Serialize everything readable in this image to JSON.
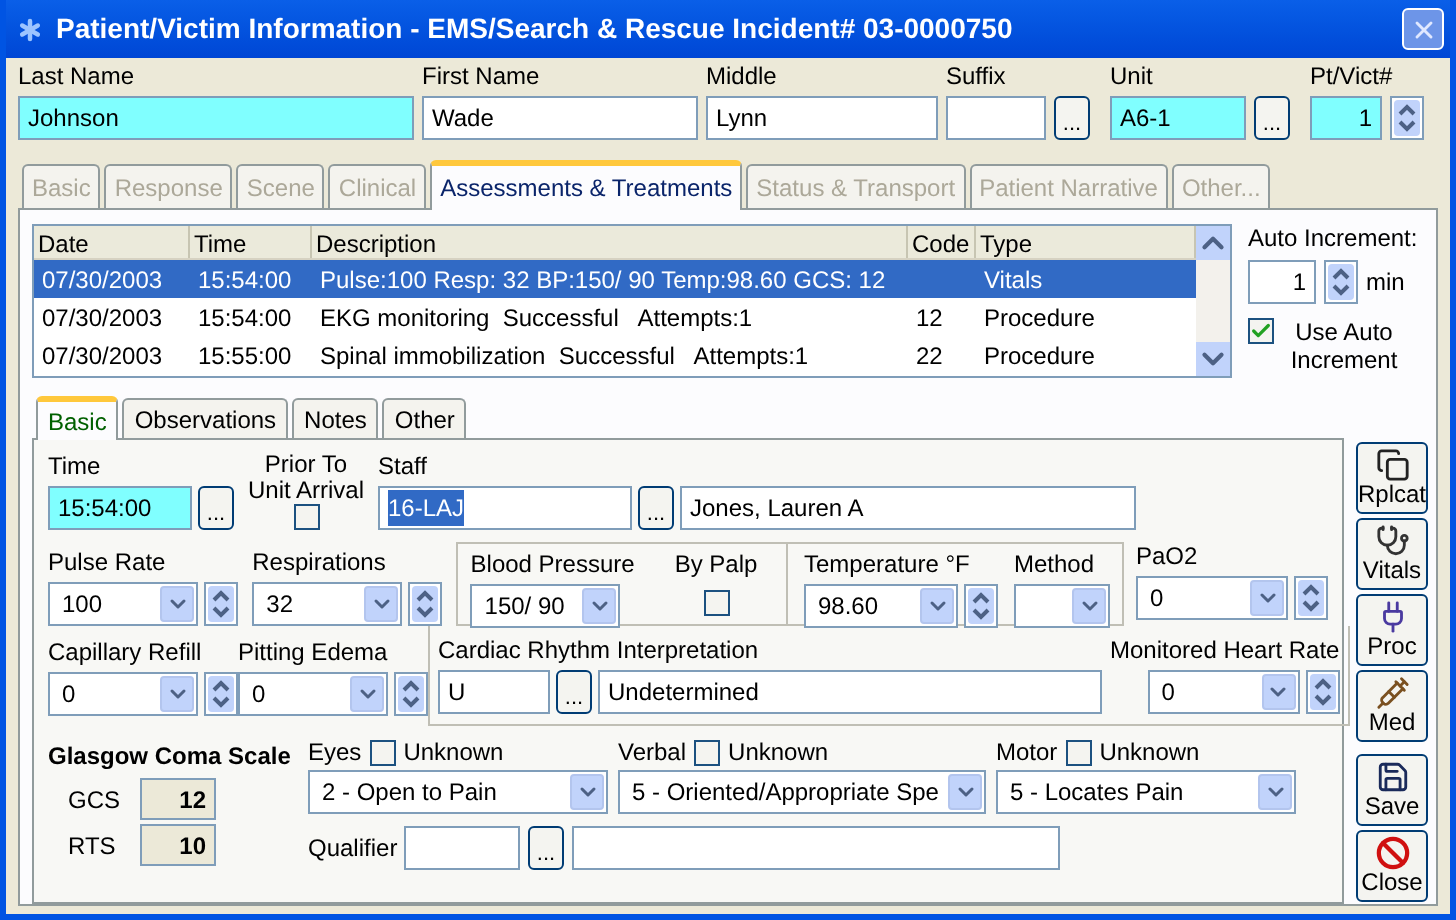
{
  "window": {
    "title": "Patient/Victim Information - EMS/Search & Rescue Incident# 03-0000750"
  },
  "header_fields": [
    {
      "label": "Last Name",
      "value": "Johnson",
      "required": true,
      "kind": "text"
    },
    {
      "label": "First Name",
      "value": "Wade",
      "required": false,
      "kind": "text"
    },
    {
      "label": "Middle",
      "value": "Lynn",
      "required": false,
      "kind": "text"
    },
    {
      "label": "Suffix",
      "required": false,
      "kind": "lookup",
      "lookup": "..."
    },
    {
      "label": "Unit",
      "value": "A6-1",
      "required": true,
      "kind": "lookup",
      "lookup": "..."
    },
    {
      "label": "Pt/Vict#",
      "value": "1",
      "required": true,
      "kind": "spin"
    }
  ],
  "tabs": [
    {
      "label": "Basic",
      "selected": false,
      "disabled": true
    },
    {
      "label": "Response",
      "selected": false,
      "disabled": true
    },
    {
      "label": "Scene",
      "selected": false,
      "disabled": true
    },
    {
      "label": "Clinical",
      "selected": false,
      "disabled": true
    },
    {
      "label": "Assessments & Treatments",
      "selected": true,
      "disabled": false
    },
    {
      "label": "Status & Transport",
      "selected": false,
      "disabled": true
    },
    {
      "label": "Patient Narrative",
      "selected": false,
      "disabled": true
    },
    {
      "label": "Other...",
      "selected": false,
      "disabled": true
    }
  ],
  "records": {
    "columns": [
      "Date",
      "Time",
      "Description",
      "Code",
      "Type"
    ],
    "rows": [
      {
        "date": "07/30/2003",
        "time": "15:54:00",
        "description": "Pulse:100 Resp: 32 BP:150/ 90 Temp:98.60 GCS: 12",
        "type": "Vitals",
        "selected": true
      },
      {
        "date": "07/30/2003",
        "time": "15:54:00",
        "description": "EKG monitoring  Successful   Attempts:1",
        "code": "12",
        "type": "Procedure",
        "selected": false
      },
      {
        "date": "07/30/2003",
        "time": "15:55:00",
        "description": "Spinal immobilization  Successful   Attempts:1",
        "code": "22",
        "type": "Procedure",
        "selected": false
      }
    ]
  },
  "auto_increment": {
    "label": "Auto Increment:",
    "value": "1",
    "unit": "min",
    "use_auto": {
      "label": "Use Auto Increment",
      "checked": true
    }
  },
  "inner_tabs": [
    {
      "label": "Basic",
      "selected": true
    },
    {
      "label": "Observations",
      "selected": false
    },
    {
      "label": "Notes",
      "selected": false
    },
    {
      "label": "Other",
      "selected": false
    }
  ],
  "time": {
    "label": "Time",
    "value": "15:54:00",
    "lookup": "..."
  },
  "prior_to_unit_arrival": {
    "label": "Prior To Unit Arrival",
    "checked": false
  },
  "staff": {
    "label": "Staff",
    "code": "16-LAJ",
    "lookup": "...",
    "name": "Jones, Lauren A"
  },
  "pulse_rate": {
    "label": "Pulse Rate",
    "value": "100"
  },
  "respirations": {
    "label": "Respirations",
    "value": "32"
  },
  "blood_pressure": {
    "label": "Blood Pressure",
    "value": "150/ 90"
  },
  "by_palp": {
    "label": "By Palp",
    "checked": false
  },
  "temperature": {
    "label": "Temperature °F",
    "value": "98.60"
  },
  "method": {
    "label": "Method"
  },
  "pao2": {
    "label": "PaO2",
    "value": "0"
  },
  "capillary_refill": {
    "label": "Capillary Refill",
    "value": "0"
  },
  "pitting_edema": {
    "label": "Pitting Edema",
    "value": "0"
  },
  "cardiac_rhythm": {
    "label": "Cardiac Rhythm Interpretation",
    "code": "U",
    "lookup": "...",
    "description": "Undetermined"
  },
  "monitored_heart_rate": {
    "label": "Monitored Heart Rate",
    "value": "0"
  },
  "glasgow": {
    "title": "Glasgow Coma Scale",
    "scores": [
      {
        "label": "GCS",
        "value": "12"
      },
      {
        "label": "RTS",
        "value": "10"
      }
    ],
    "components": [
      {
        "label": "Eyes",
        "unknown": {
          "label": "Unknown",
          "checked": false
        },
        "value": "2 - Open to Pain"
      },
      {
        "label": "Verbal",
        "unknown": {
          "label": "Unknown",
          "checked": false
        },
        "value": "5 - Oriented/Appropriate Spe"
      },
      {
        "label": "Motor",
        "unknown": {
          "label": "Unknown",
          "checked": false
        },
        "value": "5 - Locates Pain"
      }
    ],
    "qualifier": {
      "label": "Qualifier",
      "lookup": "..."
    }
  },
  "side_buttons": [
    {
      "kind": "replicate",
      "label": "Rplcat"
    },
    {
      "kind": "vitals",
      "label": "Vitals"
    },
    {
      "kind": "procedure",
      "label": "Proc"
    },
    {
      "kind": "medication",
      "label": "Med"
    },
    {
      "kind": "save",
      "label": "Save"
    },
    {
      "kind": "close",
      "label": "Close"
    }
  ]
}
